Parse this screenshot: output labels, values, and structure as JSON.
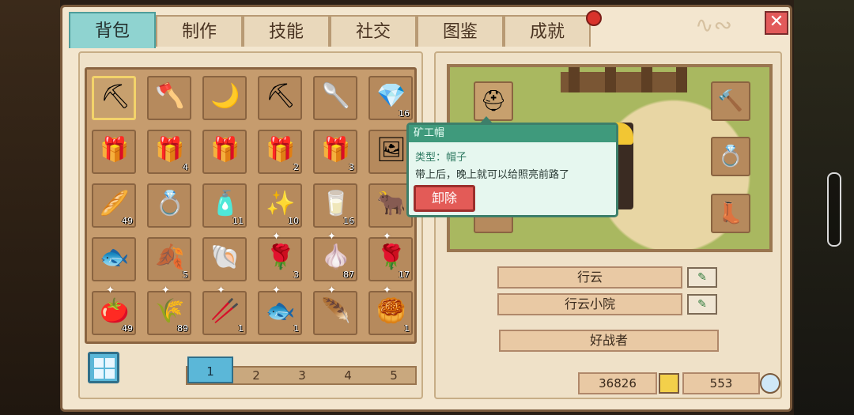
{
  "tabs": [
    "背包",
    "制作",
    "技能",
    "社交",
    "图鉴",
    "成就"
  ],
  "active_tab": 0,
  "close_icon": "close-icon",
  "inventory": [
    {
      "icon": "⛏",
      "name": "pickaxe",
      "qty": "",
      "selected": true,
      "star": false
    },
    {
      "icon": "🪓",
      "name": "axe",
      "qty": "",
      "star": false
    },
    {
      "icon": "🌙",
      "name": "sickle",
      "qty": "",
      "star": false
    },
    {
      "icon": "⛏",
      "name": "hoe",
      "qty": "",
      "star": false
    },
    {
      "icon": "🥄",
      "name": "shovel",
      "qty": "",
      "star": false
    },
    {
      "icon": "💎",
      "name": "blue-ore",
      "qty": "16",
      "star": false
    },
    {
      "icon": "🎁",
      "name": "blue-gift",
      "qty": "",
      "star": false
    },
    {
      "icon": "🎁",
      "name": "blue-gift",
      "qty": "4",
      "star": false
    },
    {
      "icon": "🎁",
      "name": "blue-gift",
      "qty": "",
      "star": false
    },
    {
      "icon": "🎁",
      "name": "red-gift",
      "qty": "2",
      "star": false
    },
    {
      "icon": "🎁",
      "name": "blue-gift",
      "qty": "3",
      "star": false
    },
    {
      "icon": "🖼",
      "name": "portrait",
      "qty": "",
      "star": false
    },
    {
      "icon": "🥖",
      "name": "bread",
      "qty": "49",
      "star": false
    },
    {
      "icon": "💍",
      "name": "ring",
      "qty": "",
      "star": false
    },
    {
      "icon": "🧴",
      "name": "jar",
      "qty": "11",
      "star": false
    },
    {
      "icon": "✨",
      "name": "seeds",
      "qty": "10",
      "star": false
    },
    {
      "icon": "🥛",
      "name": "milk",
      "qty": "16",
      "star": false
    },
    {
      "icon": "🐂",
      "name": "horned-helmet",
      "qty": "",
      "star": false
    },
    {
      "icon": "🐟",
      "name": "fish-bone",
      "qty": "",
      "star": false
    },
    {
      "icon": "🍂",
      "name": "leaf",
      "qty": "5",
      "star": false
    },
    {
      "icon": "🐚",
      "name": "fossil",
      "qty": "",
      "star": false
    },
    {
      "icon": "🌹",
      "name": "rose",
      "qty": "3",
      "star": true
    },
    {
      "icon": "🧄",
      "name": "garlic",
      "qty": "87",
      "star": true
    },
    {
      "icon": "🌹",
      "name": "red-flower",
      "qty": "17",
      "star": true
    },
    {
      "icon": "🍅",
      "name": "tomato",
      "qty": "49",
      "star": true
    },
    {
      "icon": "🌾",
      "name": "wheat",
      "qty": "89",
      "star": true
    },
    {
      "icon": "🥢",
      "name": "stick",
      "qty": "1",
      "star": true
    },
    {
      "icon": "🐟",
      "name": "tuna",
      "qty": "1",
      "star": true
    },
    {
      "icon": "🪶",
      "name": "feather-brush",
      "qty": "",
      "star": true
    },
    {
      "icon": "🥮",
      "name": "passion-fruit",
      "qty": "1",
      "star": true
    }
  ],
  "pages": [
    "1",
    "2",
    "3",
    "4",
    "5"
  ],
  "active_page": 0,
  "tooltip": {
    "title": "矿工帽",
    "type": "类型：帽子",
    "desc": "带上后，晚上就可以给照亮前路了",
    "button": "卸除"
  },
  "equipment": {
    "hat": "⛑",
    "weapon": "🔨",
    "ring": "💍",
    "boots": "👢"
  },
  "player": {
    "name": "行云",
    "farm": "行云小院",
    "title": "好战者"
  },
  "currency": {
    "gold": "36826",
    "gems": "553"
  },
  "colors": {
    "accent": "#8fd3d0",
    "danger": "#e35b57",
    "panel": "#efe1c8"
  }
}
